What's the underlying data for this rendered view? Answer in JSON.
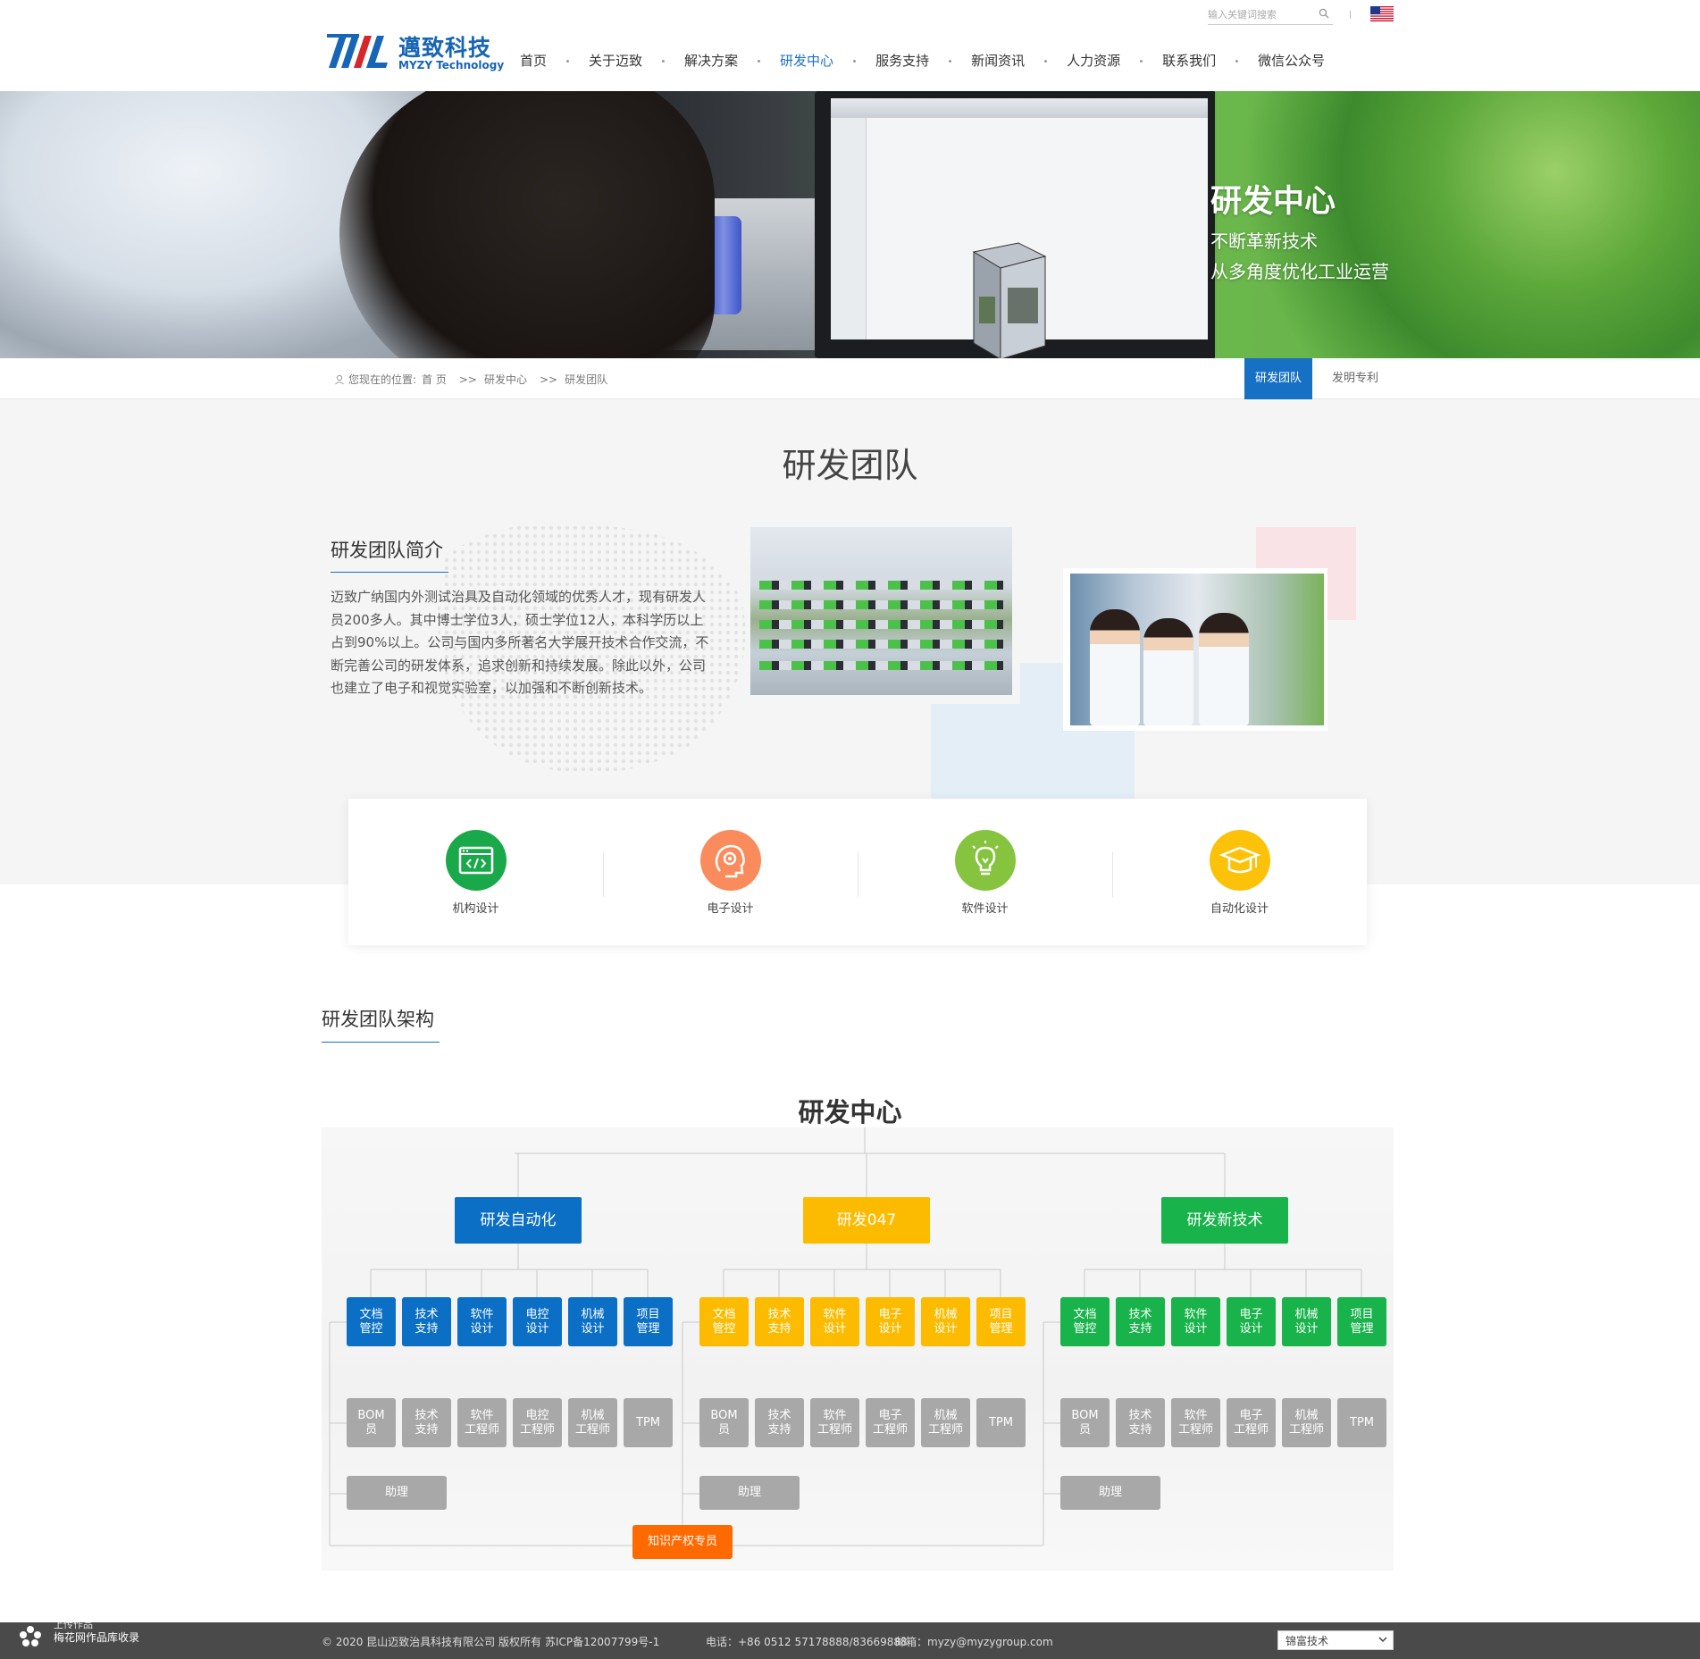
{
  "header": {
    "logo_cn": "邁致科技",
    "logo_en": "MYZY Technology",
    "search_placeholder": "输入关键词搜索",
    "nav": [
      {
        "label": "首页"
      },
      {
        "label": "关于迈致"
      },
      {
        "label": "解决方案"
      },
      {
        "label": "研发中心",
        "active": true
      },
      {
        "label": "服务支持"
      },
      {
        "label": "新闻资讯"
      },
      {
        "label": "人力资源"
      },
      {
        "label": "联系我们"
      },
      {
        "label": "微信公众号"
      }
    ],
    "accent_color": "#1a6fc6"
  },
  "banner": {
    "title": "研发中心",
    "sub1": "不断革新技术",
    "sub2": "从多角度优化工业运营"
  },
  "breadcrumb": {
    "prefix": "您现在的位置:",
    "items": [
      "首 页",
      "研发中心",
      "研发团队"
    ],
    "separator": ">>"
  },
  "subtabs": [
    {
      "label": "研发团队",
      "active": true
    },
    {
      "label": "发明专利"
    }
  ],
  "intro": {
    "page_title": "研发团队",
    "heading": "研发团队简介",
    "text": "迈致广纳国内外测试治具及自动化领域的优秀人才，现有研发人员200多人。其中博士学位3人，硕士学位12人，本科学历以上占到90%以上。公司与国内多所著名大学展开技术合作交流，不断完善公司的研发体系，追求创新和持续发展。除此以外，公司也建立了电子和视觉实验室，以加强和不断创新技术。"
  },
  "features": [
    {
      "label": "机构设计",
      "color": "#1aa94a",
      "icon": "code-window-icon"
    },
    {
      "label": "电子设计",
      "color": "#fa8b5c",
      "icon": "brain-gear-icon"
    },
    {
      "label": "软件设计",
      "color": "#86c440",
      "icon": "lightbulb-icon"
    },
    {
      "label": "自动化设计",
      "color": "#fcc20a",
      "icon": "graduation-cap-icon"
    }
  ],
  "org": {
    "heading": "研发团队架构",
    "root": "研发中心",
    "departments": [
      {
        "name": "研发自动化",
        "color": "blue",
        "roles": [
          [
            "文档",
            "管控"
          ],
          [
            "技术",
            "支持"
          ],
          [
            "软件",
            "设计"
          ],
          [
            "电控",
            "设计"
          ],
          [
            "机械",
            "设计"
          ],
          [
            "项目",
            "管理"
          ]
        ],
        "staff": [
          [
            "BOM",
            "员"
          ],
          [
            "技术",
            "支持"
          ],
          [
            "软件",
            "工程师"
          ],
          [
            "电控",
            "工程师"
          ],
          [
            "机械",
            "工程师"
          ],
          [
            "TPM"
          ]
        ],
        "assistant": "助理"
      },
      {
        "name": "研发047",
        "color": "yellow",
        "roles": [
          [
            "文档",
            "管控"
          ],
          [
            "技术",
            "支持"
          ],
          [
            "软件",
            "设计"
          ],
          [
            "电子",
            "设计"
          ],
          [
            "机械",
            "设计"
          ],
          [
            "项目",
            "管理"
          ]
        ],
        "staff": [
          [
            "BOM",
            "员"
          ],
          [
            "技术",
            "支持"
          ],
          [
            "软件",
            "工程师"
          ],
          [
            "电子",
            "工程师"
          ],
          [
            "机械",
            "工程师"
          ],
          [
            "TPM"
          ]
        ],
        "assistant": "助理"
      },
      {
        "name": "研发新技术",
        "color": "green",
        "roles": [
          [
            "文档",
            "管控"
          ],
          [
            "技术",
            "支持"
          ],
          [
            "软件",
            "设计"
          ],
          [
            "电子",
            "设计"
          ],
          [
            "机械",
            "设计"
          ],
          [
            "项目",
            "管理"
          ]
        ],
        "staff": [
          [
            "BOM",
            "员"
          ],
          [
            "技术",
            "支持"
          ],
          [
            "软件",
            "工程师"
          ],
          [
            "电子",
            "工程师"
          ],
          [
            "机械",
            "工程师"
          ],
          [
            "TPM"
          ]
        ],
        "assistant": "助理"
      }
    ],
    "ip_specialist": "知识产权专员"
  },
  "footer": {
    "copyright": "© 2020 昆山迈致治具科技有限公司 版权所有",
    "icp": "苏ICP备12007799号-1",
    "tel": "电话：+86 0512 57178888/83669888",
    "mail": "邮箱：myzy@myzygroup.com",
    "select_value": "锦富技术"
  },
  "watermark": {
    "top": "上传作品",
    "bottom": "梅花网作品库收录"
  }
}
